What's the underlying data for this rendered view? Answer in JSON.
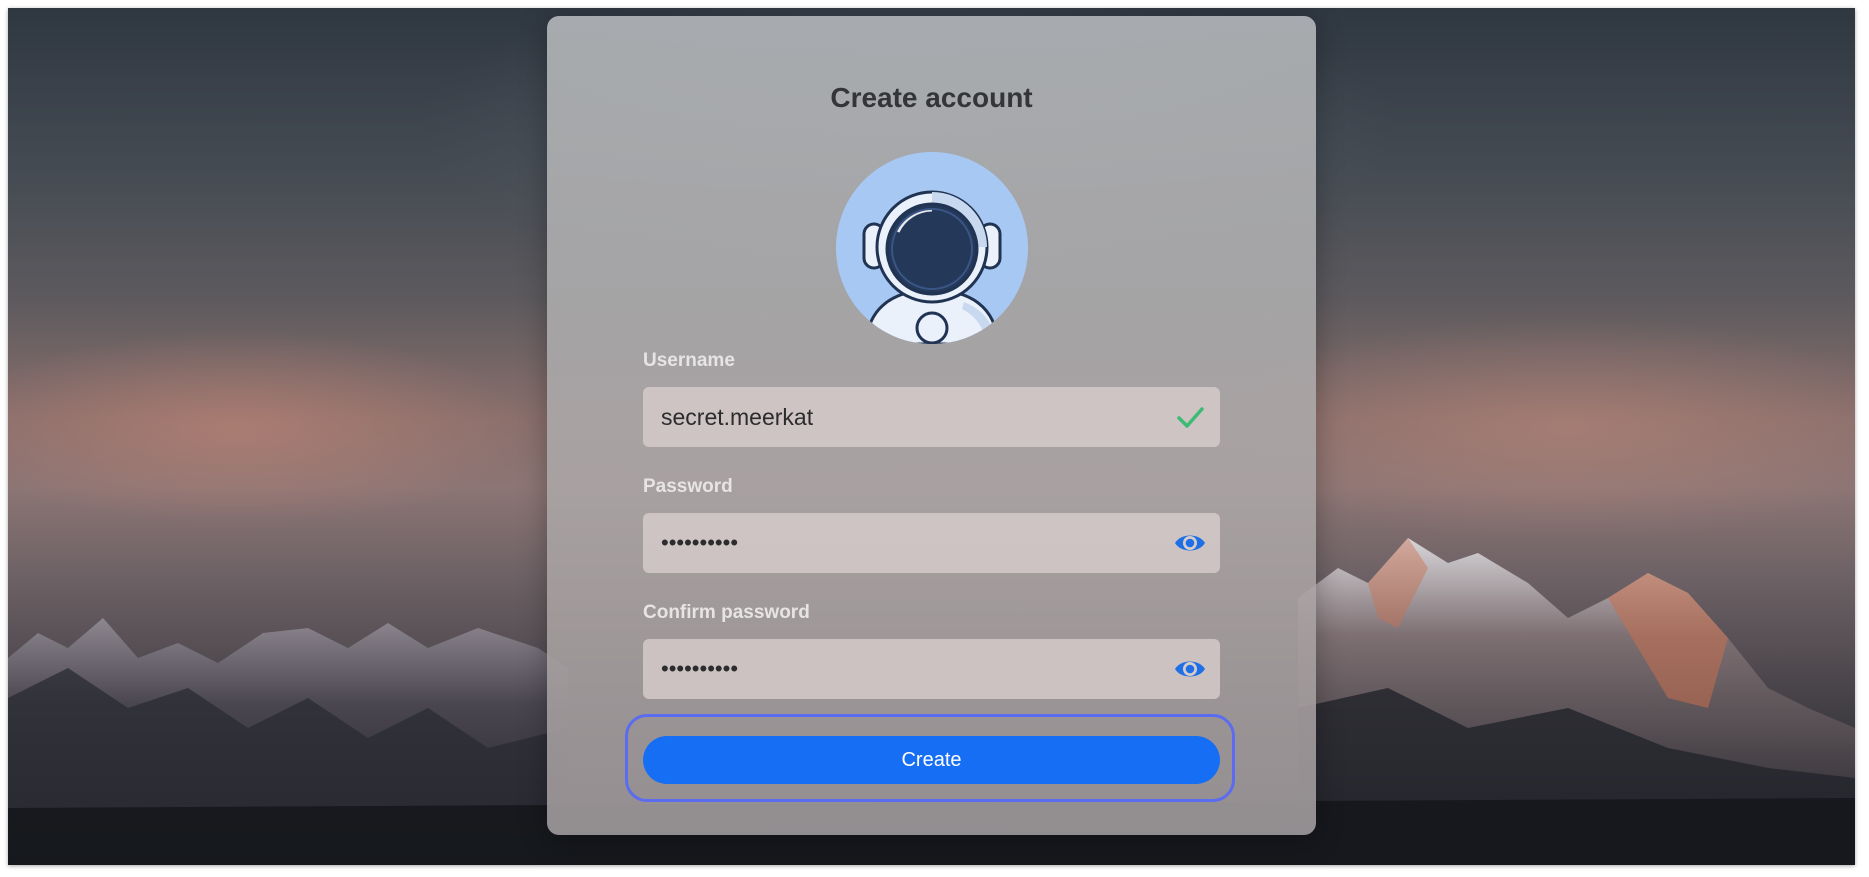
{
  "form": {
    "title": "Create account",
    "username_label": "Username",
    "username_value": "secret.meerkat",
    "password_label": "Password",
    "password_value": "••••••••••",
    "confirm_label": "Confirm password",
    "confirm_value": "••••••••••",
    "submit_label": "Create"
  },
  "icons": {
    "username_status": "check-icon",
    "password_toggle": "eye-icon",
    "confirm_toggle": "eye-icon",
    "avatar": "astronaut-avatar"
  },
  "colors": {
    "accent": "#166ef4",
    "focus_ring": "#5b6cf0",
    "valid": "#3dbb74",
    "eye_icon": "#1f6fe6"
  }
}
